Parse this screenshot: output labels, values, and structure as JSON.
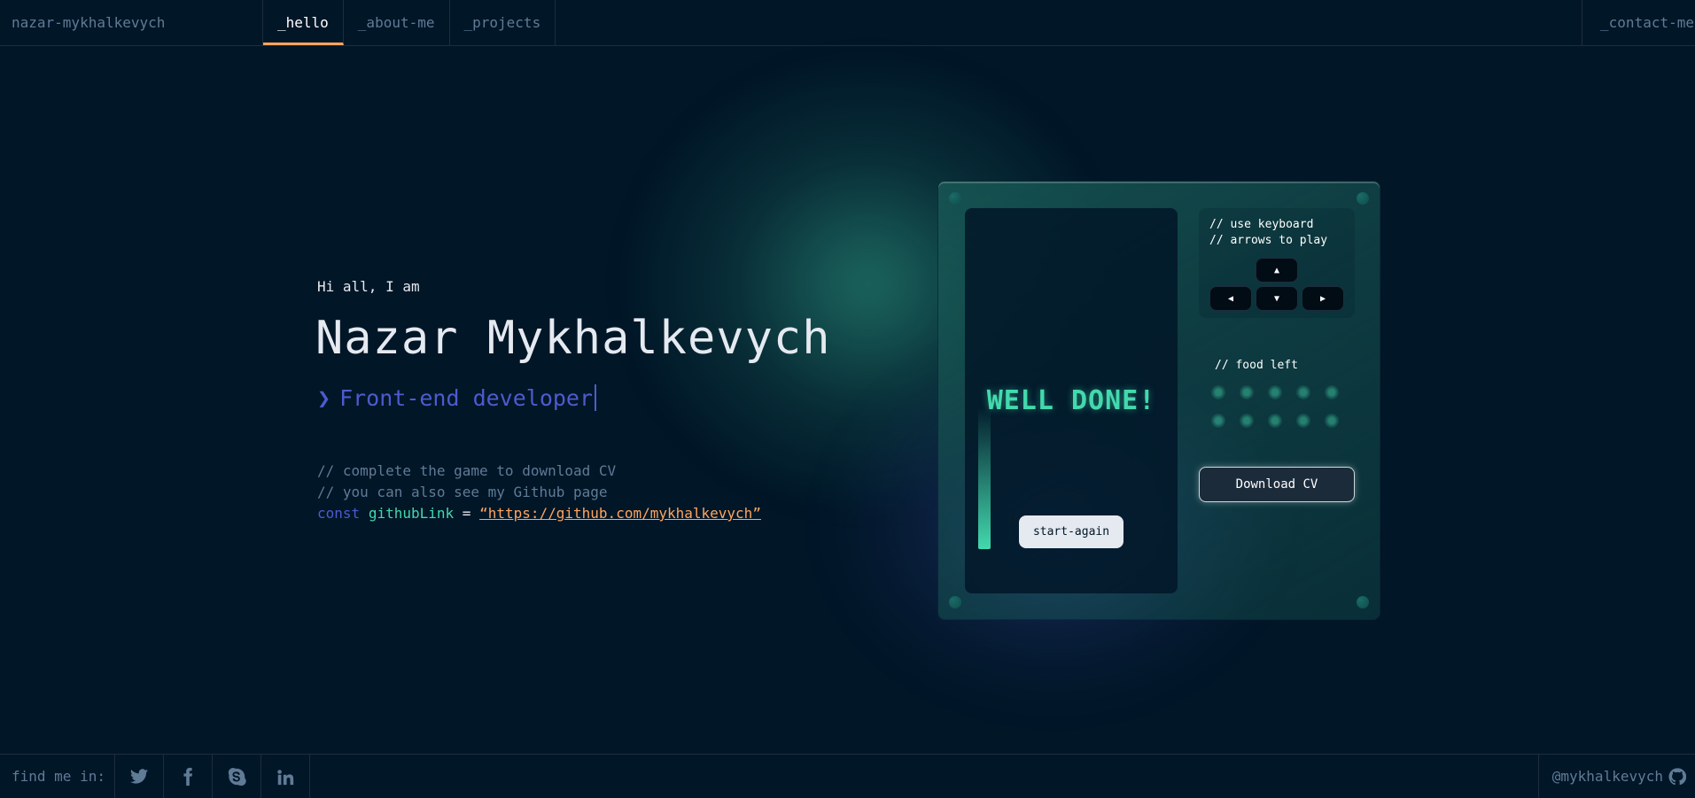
{
  "header": {
    "logo": "nazar-mykhalkevych",
    "tabs": [
      {
        "label": "_hello",
        "active": true
      },
      {
        "label": "_about-me",
        "active": false
      },
      {
        "label": "_projects",
        "active": false
      }
    ],
    "contact": "_contact-me"
  },
  "hero": {
    "greeting": "Hi all, I am",
    "name": "Nazar Mykhalkevych",
    "role_prefix": "❯",
    "role": "Front-end developer",
    "comment1": "// complete the game to download CV",
    "comment2": "// you can also see my Github page",
    "code_keyword": "const",
    "code_var": "githubLink",
    "code_eq": "=",
    "code_value": "“https://github.com/mykhalkevych”"
  },
  "game": {
    "status": "WELL DONE!",
    "restart_label": "start-again",
    "instructions_line1": "// use keyboard",
    "instructions_line2": "// arrows to play",
    "keys": {
      "up": "▲",
      "left": "◀",
      "down": "▼",
      "right": "▶"
    },
    "food_label": "// food left",
    "food_count": 10,
    "download_label": "Download CV"
  },
  "footer": {
    "find_label": "find me in:",
    "socials": [
      "twitter-icon",
      "facebook-icon",
      "skype-icon",
      "linkedin-icon"
    ],
    "handle": "@mykhalkevych"
  },
  "colors": {
    "background": "#011627",
    "text_muted": "#607b96",
    "accent_green": "#43d9ad",
    "accent_blue": "#4d5bce",
    "accent_orange": "#fea55f"
  }
}
